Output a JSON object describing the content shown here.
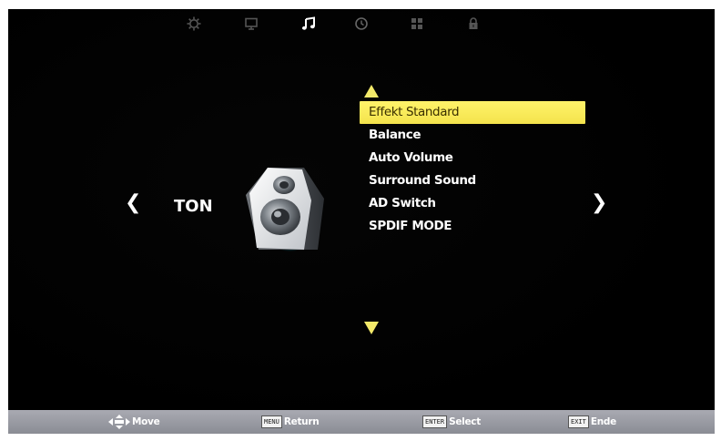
{
  "categories": [
    {
      "icon": "gear-icon",
      "active": false
    },
    {
      "icon": "monitor-icon",
      "active": false
    },
    {
      "icon": "music-note-icon",
      "active": true
    },
    {
      "icon": "clock-icon",
      "active": false
    },
    {
      "icon": "grid-icon",
      "active": false
    },
    {
      "icon": "lock-icon",
      "active": false
    }
  ],
  "section": {
    "title": "TON",
    "left_arrow": "❮",
    "right_arrow": "❯"
  },
  "menu": {
    "items": [
      {
        "label": "Effekt Standard",
        "selected": true
      },
      {
        "label": "Balance",
        "selected": false
      },
      {
        "label": "Auto Volume",
        "selected": false
      },
      {
        "label": "Surround Sound",
        "selected": false
      },
      {
        "label": "AD Switch",
        "selected": false
      },
      {
        "label": "SPDIF MODE",
        "selected": false
      }
    ]
  },
  "help": {
    "move": {
      "label": "Move"
    },
    "return": {
      "key": "MENU",
      "label": "Return"
    },
    "select": {
      "key": "ENTER",
      "label": "Select"
    },
    "exit": {
      "key": "EXIT",
      "label": "Ende"
    }
  },
  "colors": {
    "highlight": "#f4e34c",
    "accent_arrow": "#f3e96a",
    "background": "#000000",
    "helpbar": "#9a9ca4"
  }
}
